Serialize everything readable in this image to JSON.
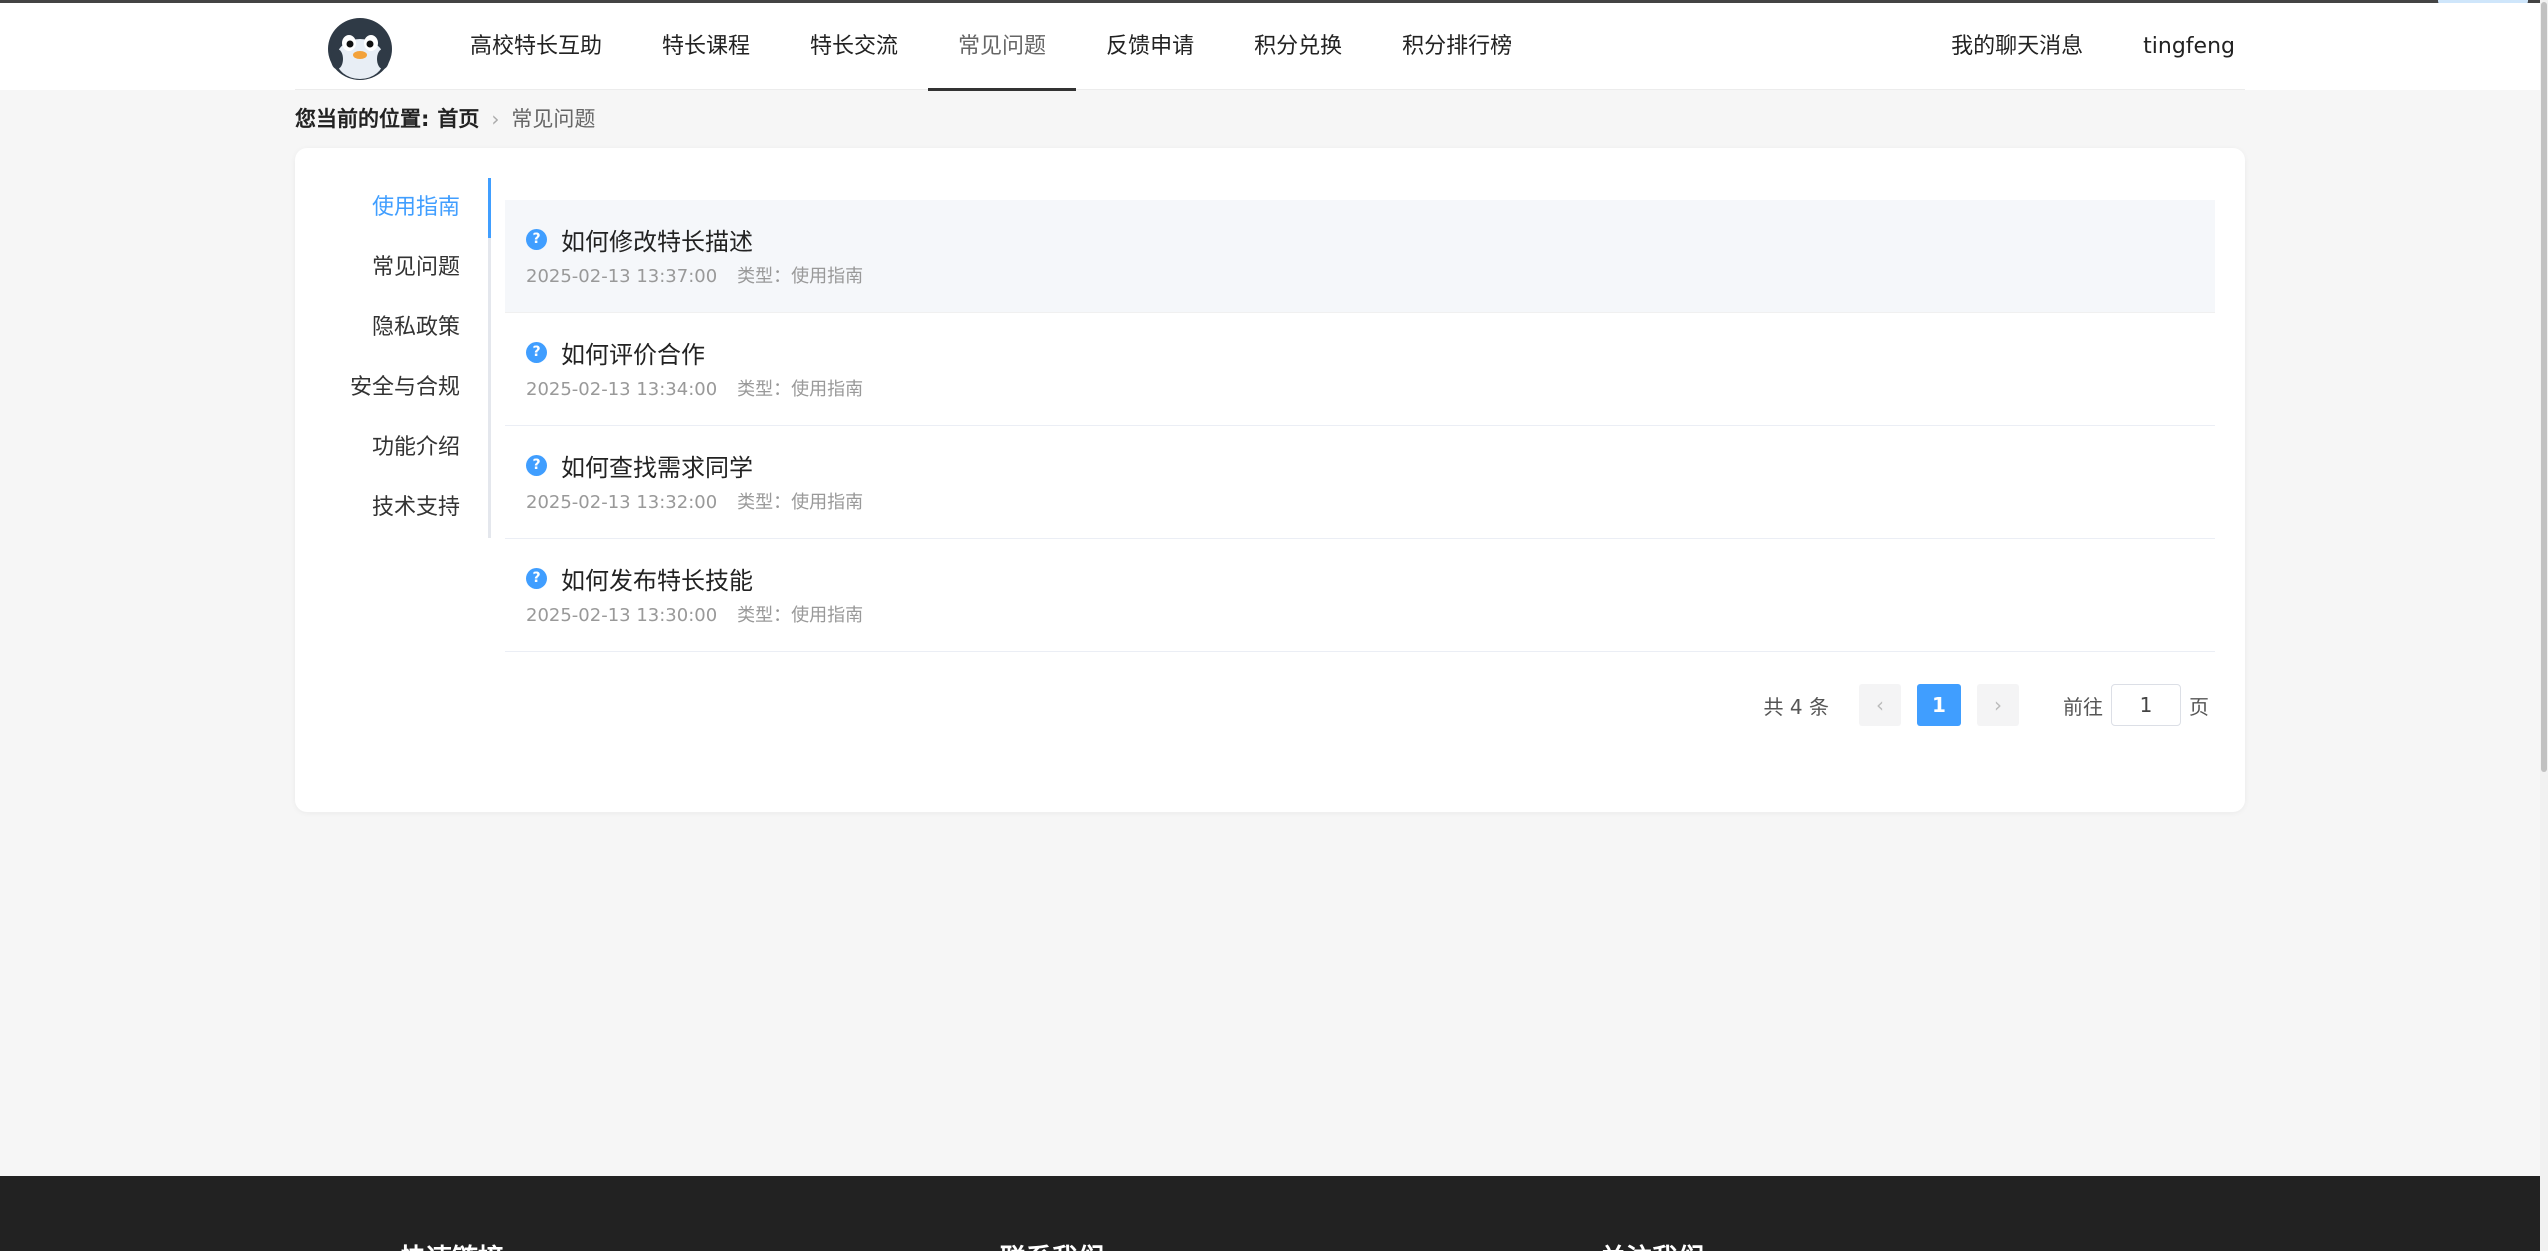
{
  "nav": {
    "items": [
      "高校特长互助",
      "特长课程",
      "特长交流",
      "常见问题",
      "反馈申请",
      "积分兑换",
      "积分排行榜"
    ],
    "active_index": 3,
    "messages_label": "我的聊天消息",
    "username": "tingfeng"
  },
  "breadcrumb": {
    "label": "您当前的位置:",
    "home": "首页",
    "current": "常见问题"
  },
  "sidebar": {
    "items": [
      "使用指南",
      "常见问题",
      "隐私政策",
      "安全与合规",
      "功能介绍",
      "技术支持"
    ],
    "active_index": 0
  },
  "faqs": [
    {
      "title": "如何修改特长描述",
      "time": "2025-02-13 13:37:00",
      "type": "类型：使用指南"
    },
    {
      "title": "如何评价合作",
      "time": "2025-02-13 13:34:00",
      "type": "类型：使用指南"
    },
    {
      "title": "如何查找需求同学",
      "time": "2025-02-13 13:32:00",
      "type": "类型：使用指南"
    },
    {
      "title": "如何发布特长技能",
      "time": "2025-02-13 13:30:00",
      "type": "类型：使用指南"
    }
  ],
  "pagination": {
    "total": "共 4 条",
    "current_page": "1",
    "goto_label": "前往",
    "goto_value": "1",
    "page_suffix": "页"
  },
  "footer": {
    "col1": "快速链接",
    "col2": "联系我们",
    "col3": "关注我们"
  },
  "colors": {
    "accent": "#409eff",
    "footer_bg": "#222222",
    "page_bg": "#f6f6f6"
  },
  "icons": {
    "question": "question-circle-icon",
    "prev": "chevron-left-icon",
    "next": "chevron-right-icon",
    "breadcrumb_sep": "chevron-right-icon"
  }
}
